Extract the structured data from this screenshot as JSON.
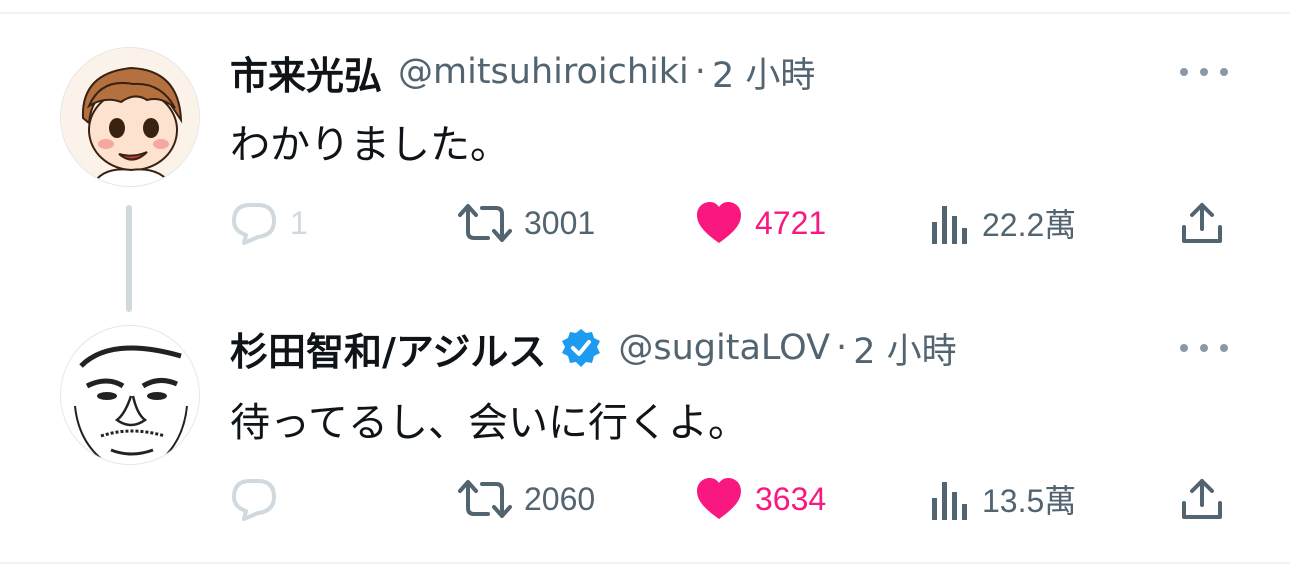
{
  "tweets": [
    {
      "name": "市来光弘",
      "handle": "@mitsuhiroichiki",
      "separator": "·",
      "time": "2 小時",
      "verified": false,
      "text": "わかりました。",
      "actions": {
        "reply": "1",
        "retweet": "3001",
        "like": "4721",
        "views": "22.2萬"
      }
    },
    {
      "name": "杉田智和/アジルス",
      "handle": "@sugitaLOV",
      "separator": "·",
      "time": "2 小時",
      "verified": true,
      "text": "待ってるし、会いに行くよ。",
      "actions": {
        "reply": "",
        "retweet": "2060",
        "like": "3634",
        "views": "13.5萬"
      }
    }
  ],
  "colors": {
    "text": "#0f1419",
    "secondary": "#536471",
    "like": "#f91880",
    "verified": "#1d9bf0",
    "divider": "#eff3f4"
  },
  "icons": [
    "reply-icon",
    "retweet-icon",
    "heart-icon",
    "views-icon",
    "share-icon",
    "more-icon",
    "verified-badge-icon"
  ]
}
